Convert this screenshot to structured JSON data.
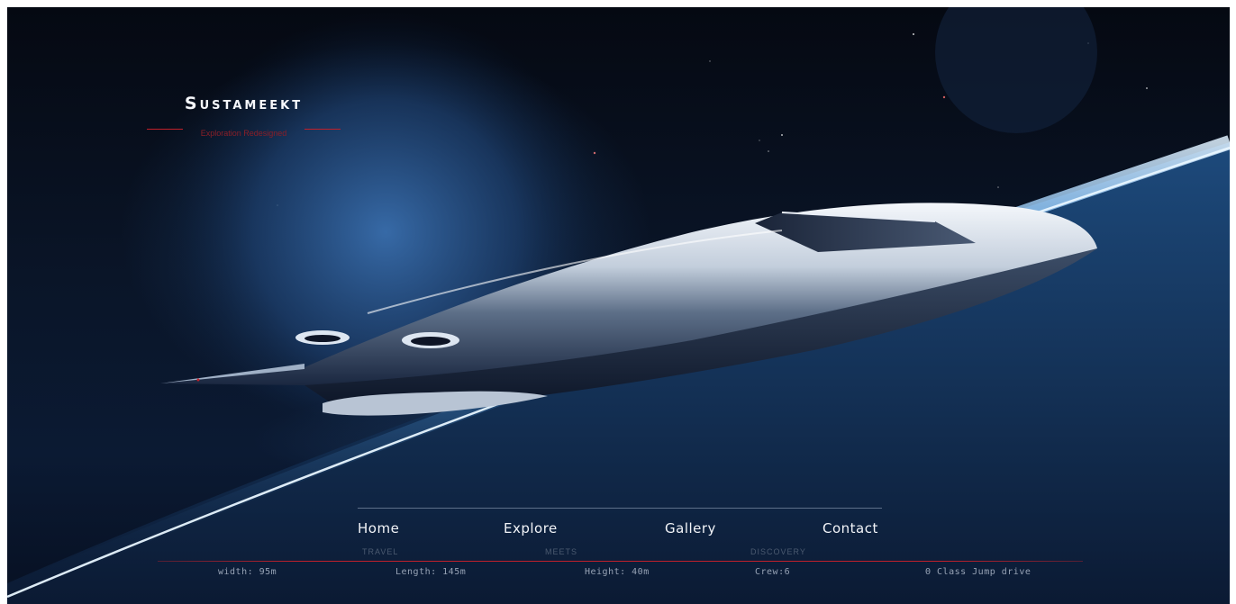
{
  "brand": {
    "title": "Sustameekt",
    "tagline": "Exploration Redesigned"
  },
  "nav": {
    "items": [
      {
        "label": "Home"
      },
      {
        "label": "Explore"
      },
      {
        "label": "Gallery"
      },
      {
        "label": "Contact"
      }
    ],
    "subs": [
      "TRAVEL",
      "MEETS",
      "DISCOVERY"
    ]
  },
  "specs": [
    "width: 95m",
    "Length: 145m",
    "Height: 40m",
    "Crew:6",
    "Θ Class Jump drive"
  ],
  "colors": {
    "accent_red": "#c0202a",
    "text_light": "#f2f4f8",
    "background": "#0a1528"
  },
  "hero_image": {
    "icon": "spaceship-icon"
  }
}
